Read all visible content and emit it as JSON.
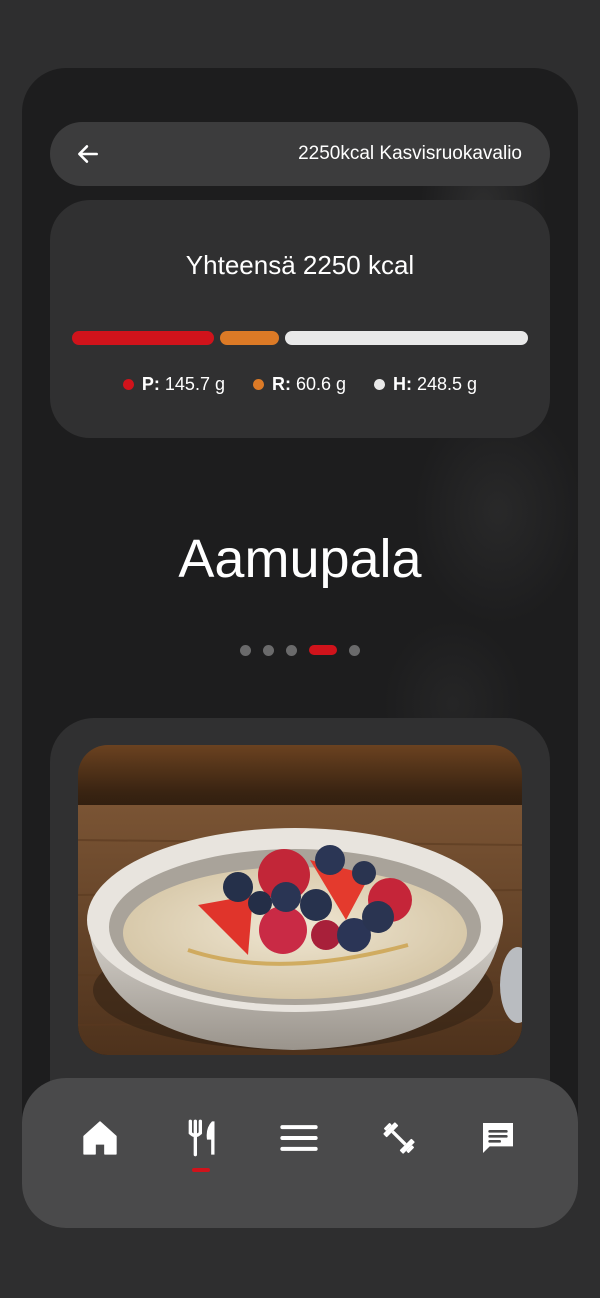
{
  "header": {
    "title": "2250kcal Kasvisruokavalio",
    "back_icon": "arrow-left-icon"
  },
  "summary": {
    "total_label": "Yhteensä 2250 kcal",
    "macros": [
      {
        "key": "P:",
        "value": "145.7 g",
        "color": "#d0131b"
      },
      {
        "key": "R:",
        "value": "60.6 g",
        "color": "#dc7a26"
      },
      {
        "key": "H:",
        "value": "248.5 g",
        "color": "#e9e9e9"
      }
    ]
  },
  "meal": {
    "title": "Aamupala",
    "pager": {
      "count": 5,
      "active_index": 3
    },
    "image": "oatmeal-bowl-with-berries"
  },
  "bottom_nav": {
    "items": [
      {
        "icon": "home-icon"
      },
      {
        "icon": "fork-knife-icon",
        "active": true
      },
      {
        "icon": "menu-icon"
      },
      {
        "icon": "dumbbell-icon"
      },
      {
        "icon": "chat-icon"
      }
    ],
    "accent_color": "#d0131b"
  }
}
